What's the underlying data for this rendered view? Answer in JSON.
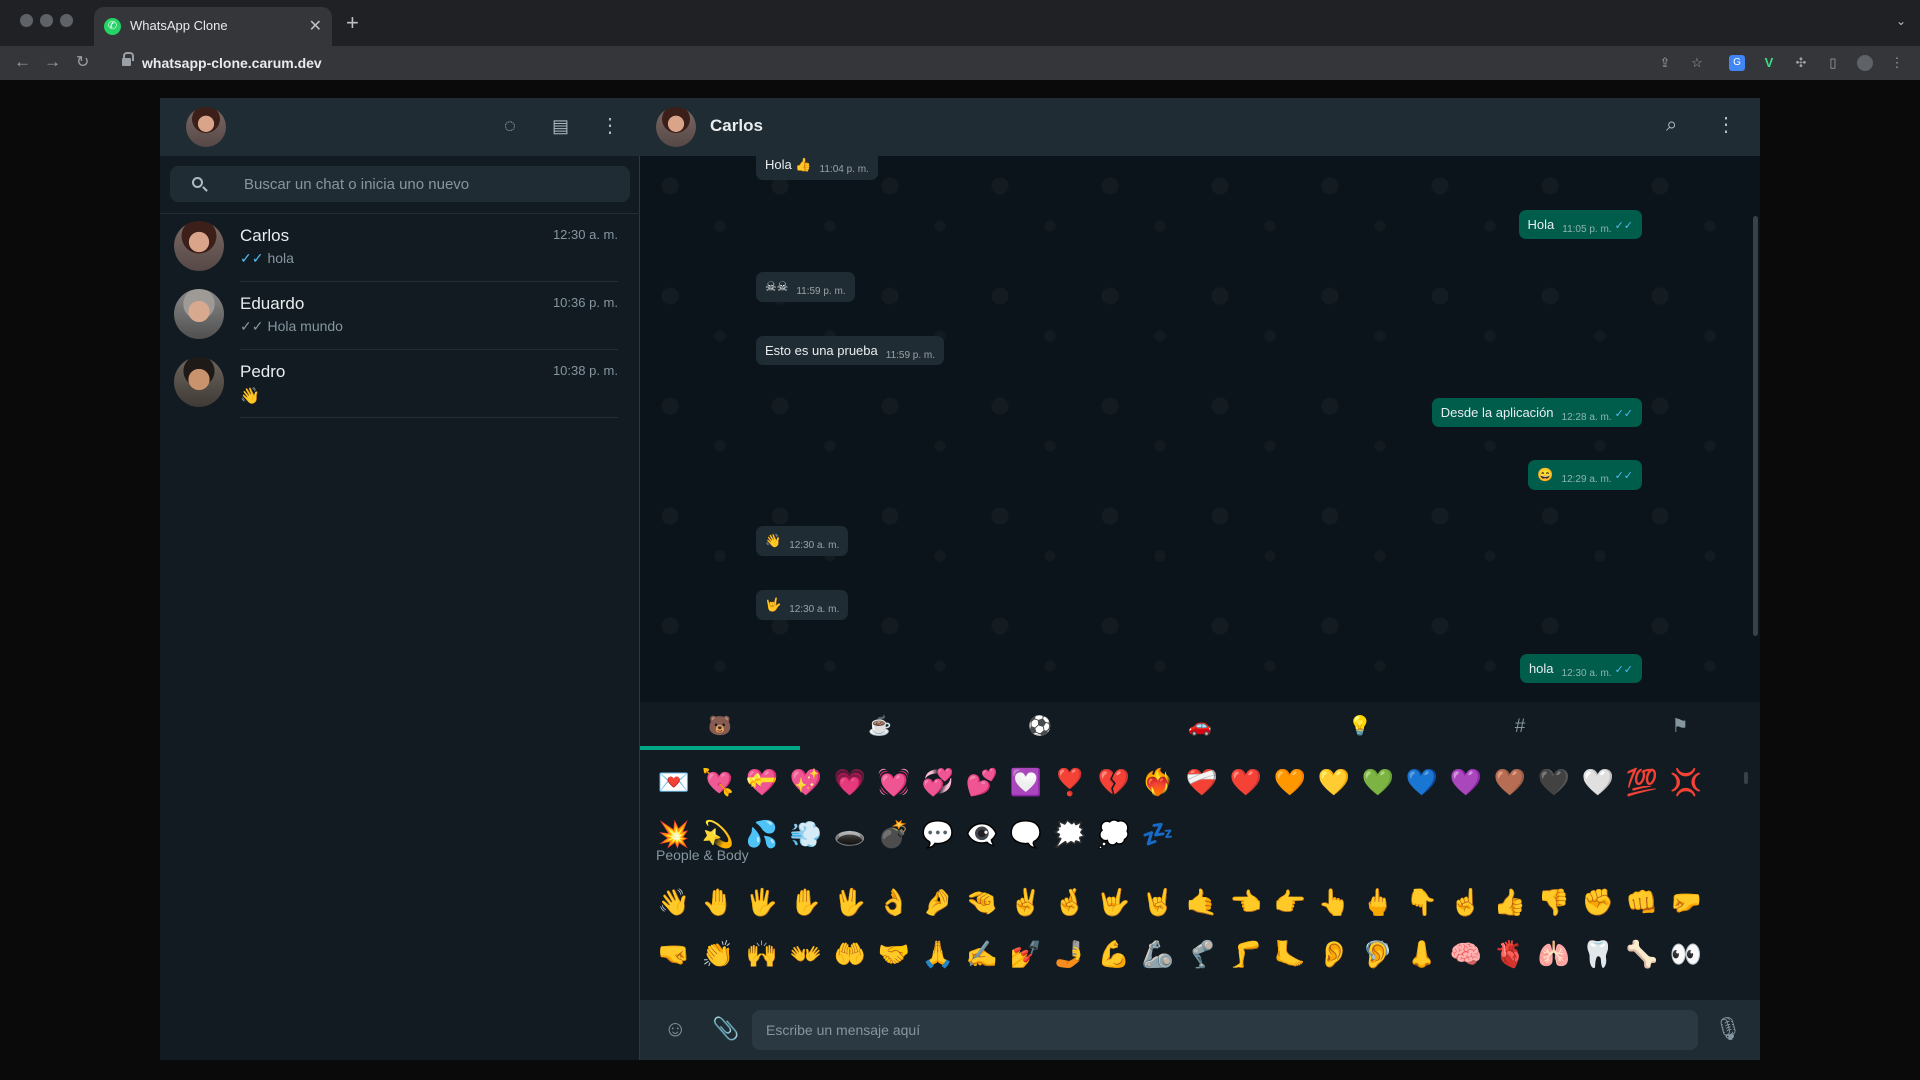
{
  "browser": {
    "tab_title": "WhatsApp Clone",
    "url": "whatsapp-clone.carum.dev"
  },
  "sidebar": {
    "search_placeholder": "Buscar un chat o inicia uno nuevo",
    "chats": [
      {
        "name": "Carlos",
        "time": "12:30 a. m.",
        "last": "hola",
        "tick": "✓✓"
      },
      {
        "name": "Eduardo",
        "time": "10:36 p. m.",
        "last": "Hola mundo",
        "tick": "✓✓"
      },
      {
        "name": "Pedro",
        "time": "10:38 p. m.",
        "last": "👋",
        "tick": ""
      }
    ]
  },
  "conversation": {
    "contact_name": "Carlos",
    "messages": [
      {
        "text": "Hola 👍",
        "time": "11:04 p. m.",
        "dir": "in"
      },
      {
        "text": "Hola",
        "time": "11:05 p. m.",
        "dir": "out"
      },
      {
        "text": "☠☠",
        "time": "11:59 p. m.",
        "dir": "in"
      },
      {
        "text": "Esto es una prueba",
        "time": "11:59 p. m.",
        "dir": "in"
      },
      {
        "text": "Desde la aplicación",
        "time": "12:28 a. m.",
        "dir": "out"
      },
      {
        "text": "😄",
        "time": "12:29 a. m.",
        "dir": "out"
      },
      {
        "text": "👋",
        "time": "12:30 a. m.",
        "dir": "in"
      },
      {
        "text": "🤟",
        "time": "12:30 a. m.",
        "dir": "in"
      },
      {
        "text": "hola",
        "time": "12:30 a. m.",
        "dir": "out"
      }
    ],
    "read_ticks": "✓✓"
  },
  "emoji_panel": {
    "section_label": "People & Body",
    "row1": [
      "💌",
      "💘",
      "💝",
      "💖",
      "💗",
      "💓",
      "💞",
      "💕",
      "💟",
      "❣️",
      "💔",
      "❤️‍🔥",
      "❤️‍🩹",
      "❤️",
      "🧡",
      "💛",
      "💚",
      "💙",
      "💜",
      "🤎",
      "🖤",
      "🤍",
      "💯",
      "💢"
    ],
    "row2": [
      "💥",
      "💫",
      "💦",
      "💨",
      "🕳️",
      "💣",
      "💬",
      "👁️‍🗨️",
      "🗨️",
      "🗯️",
      "💭",
      "💤"
    ],
    "row3": [
      "👋",
      "🤚",
      "🖐️",
      "✋",
      "🖖",
      "👌",
      "🤌",
      "🤏",
      "✌️",
      "🤞",
      "🤟",
      "🤘",
      "🤙",
      "👈",
      "👉",
      "👆",
      "🖕",
      "👇",
      "☝️",
      "👍",
      "👎",
      "✊",
      "👊",
      "🤛"
    ],
    "row4": [
      "🤜",
      "👏",
      "🙌",
      "👐",
      "🤲",
      "🤝",
      "🙏",
      "✍️",
      "💅",
      "🤳",
      "💪",
      "🦾",
      "🦿",
      "🦵",
      "🦶",
      "👂",
      "🦻",
      "👃",
      "🧠",
      "🫀",
      "🫁",
      "🦷",
      "🦴",
      "👀"
    ]
  },
  "compose": {
    "placeholder": "Escribe un mensaje aquí"
  },
  "colors": {
    "accent": "#00a884",
    "outgoing_bubble": "#005c4b",
    "incoming_bubble": "#202c33",
    "read_tick": "#53bdeb"
  }
}
